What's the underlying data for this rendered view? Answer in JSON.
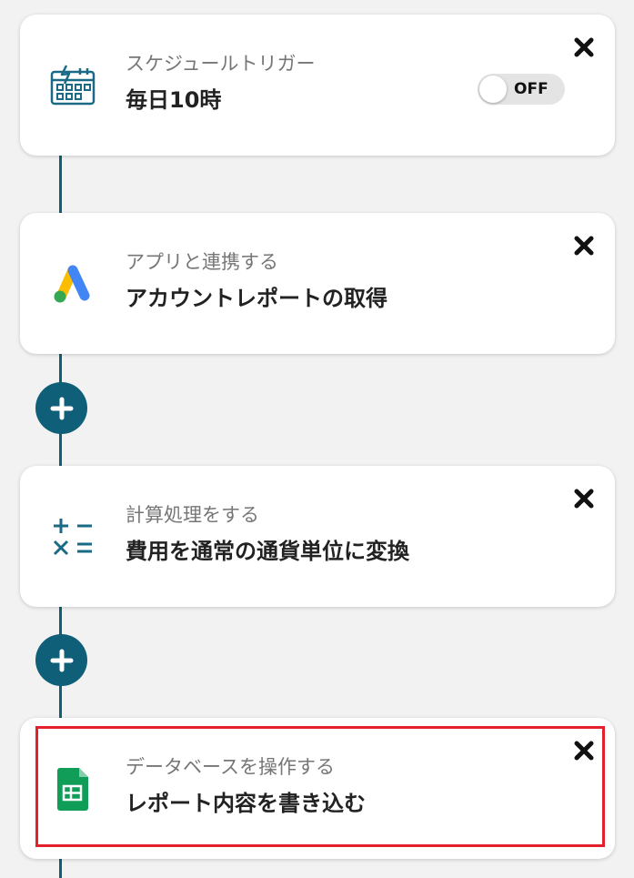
{
  "steps": [
    {
      "subtitle": "スケジュールトリガー",
      "title": "毎日10時",
      "icon": "calendar-lightning-icon",
      "toggle_label": "OFF"
    },
    {
      "subtitle": "アプリと連携する",
      "title": "アカウントレポートの取得",
      "icon": "google-ads-icon"
    },
    {
      "subtitle": "計算処理をする",
      "title": "費用を通常の通貨単位に変換",
      "icon": "calculator-operators-icon"
    },
    {
      "subtitle": "データベースを操作する",
      "title": "レポート内容を書き込む",
      "icon": "google-sheets-icon"
    }
  ],
  "colors": {
    "connector": "#0f5f79",
    "highlight": "#e3202b",
    "background": "#f2f2f2"
  }
}
